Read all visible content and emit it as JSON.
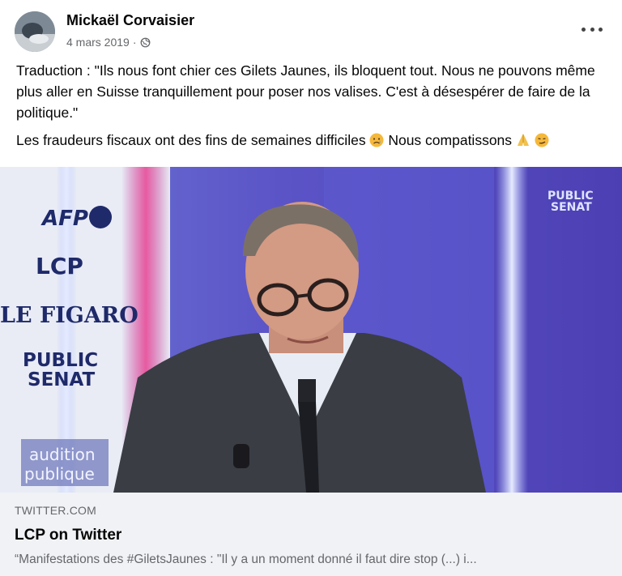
{
  "post": {
    "author": "Mickaël Corvaisier",
    "date": "4 mars 2019",
    "separator": "·",
    "privacy_icon": "globe-icon",
    "menu_icon": "more-options-icon",
    "text_line1": "Traduction : \"Ils nous font chier ces Gilets Jaunes, ils bloquent tout. Nous ne pouvons même plus aller en Suisse tranquillement pour poser nos valises. C'est à désespérer de faire de la politique.\"",
    "text_line2_a": "Les fraudeurs fiscaux ont des fins de semaines difficiles",
    "text_line2_b": "Nous compatissons",
    "emojis": [
      "sad-face-emoji",
      "praying-hands-emoji",
      "smirking-face-emoji"
    ]
  },
  "image": {
    "logos": [
      "AFP",
      "LCP",
      "LE FIGARO",
      "PUBLIC",
      "SENAT"
    ],
    "corner_logo_line1": "PUBLIC",
    "corner_logo_line2": "SENAT",
    "badge_line1": "audition",
    "badge_line2": "publique"
  },
  "link": {
    "domain": "TWITTER.COM",
    "title": "LCP on Twitter",
    "description": "“Manifestations des #GiletsJaunes : \"Il y a un moment donné il faut dire stop (...) i..."
  },
  "colors": {
    "link_bg": "#f0f2f5",
    "meta_text": "#65676b",
    "studio_purple": "#5a52c8"
  }
}
